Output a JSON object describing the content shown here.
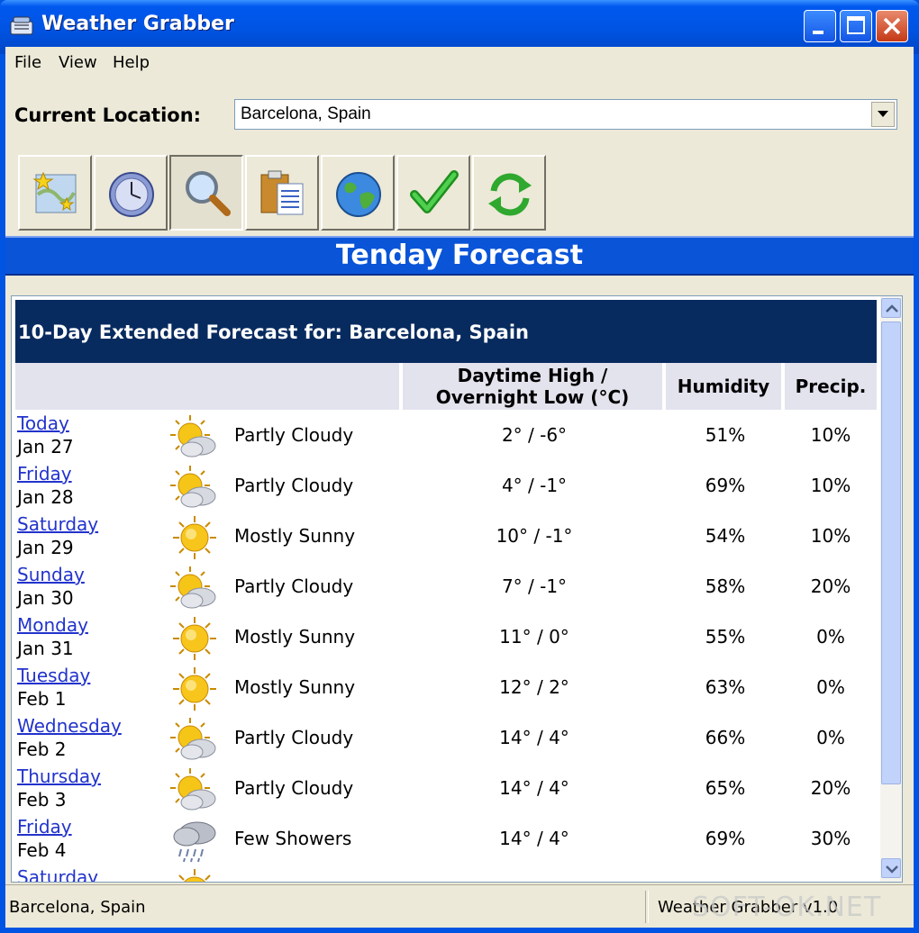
{
  "window": {
    "title": "Weather Grabber"
  },
  "menu": {
    "items": [
      "File",
      "View",
      "Help"
    ]
  },
  "location": {
    "label": "Current Location:",
    "value": "Barcelona, Spain"
  },
  "toolbar": {
    "icons": [
      "favorites-map-icon",
      "clock-icon",
      "magnifier-icon",
      "clipboard-icon",
      "globe-icon",
      "checkmark-icon",
      "refresh-icon"
    ],
    "pressed_index": 2
  },
  "banner": {
    "title": "Tenday Forecast"
  },
  "forecast": {
    "header": "10-Day Extended Forecast for: Barcelona, Spain",
    "columns": {
      "temp": "Daytime High / Overnight Low (°C)",
      "temp_line1": "Daytime High /",
      "temp_line2": "Overnight Low (°C)",
      "humidity": "Humidity",
      "precip": "Precip."
    },
    "rows": [
      {
        "day": "Today",
        "date": "Jan 27",
        "icon": "partly-cloudy",
        "condition": "Partly Cloudy",
        "temp": "2° / -6°",
        "humidity": "51%",
        "precip": "10%"
      },
      {
        "day": "Friday",
        "date": "Jan 28",
        "icon": "partly-cloudy",
        "condition": "Partly Cloudy",
        "temp": "4° / -1°",
        "humidity": "69%",
        "precip": "10%"
      },
      {
        "day": "Saturday",
        "date": "Jan 29",
        "icon": "mostly-sunny",
        "condition": "Mostly Sunny",
        "temp": "10° / -1°",
        "humidity": "54%",
        "precip": "10%"
      },
      {
        "day": "Sunday",
        "date": "Jan 30",
        "icon": "partly-cloudy",
        "condition": "Partly Cloudy",
        "temp": "7° / -1°",
        "humidity": "58%",
        "precip": "20%"
      },
      {
        "day": "Monday",
        "date": "Jan 31",
        "icon": "mostly-sunny",
        "condition": "Mostly Sunny",
        "temp": "11° / 0°",
        "humidity": "55%",
        "precip": "0%"
      },
      {
        "day": "Tuesday",
        "date": "Feb 1",
        "icon": "mostly-sunny",
        "condition": "Mostly Sunny",
        "temp": "12° / 2°",
        "humidity": "63%",
        "precip": "0%"
      },
      {
        "day": "Wednesday",
        "date": "Feb 2",
        "icon": "partly-cloudy",
        "condition": "Partly Cloudy",
        "temp": "14° / 4°",
        "humidity": "66%",
        "precip": "0%"
      },
      {
        "day": "Thursday",
        "date": "Feb 3",
        "icon": "partly-cloudy",
        "condition": "Partly Cloudy",
        "temp": "14° / 4°",
        "humidity": "65%",
        "precip": "20%"
      },
      {
        "day": "Friday",
        "date": "Feb 4",
        "icon": "few-showers",
        "condition": "Few Showers",
        "temp": "14° / 4°",
        "humidity": "69%",
        "precip": "30%"
      },
      {
        "day": "Saturday",
        "date": "",
        "icon": "mostly-sunny",
        "condition": "",
        "temp": "",
        "humidity": "",
        "precip": ""
      }
    ]
  },
  "status": {
    "left": "Barcelona, Spain",
    "right": "Weather Grabber v1.0"
  },
  "watermark": "SOFT-OK.NET",
  "colors": {
    "title_blue": "#0054e3",
    "banner_blue": "#0a54d8",
    "header_navy": "#082b5f",
    "link_blue": "#2233cc",
    "column_header_bg": "#e3e3ee"
  }
}
